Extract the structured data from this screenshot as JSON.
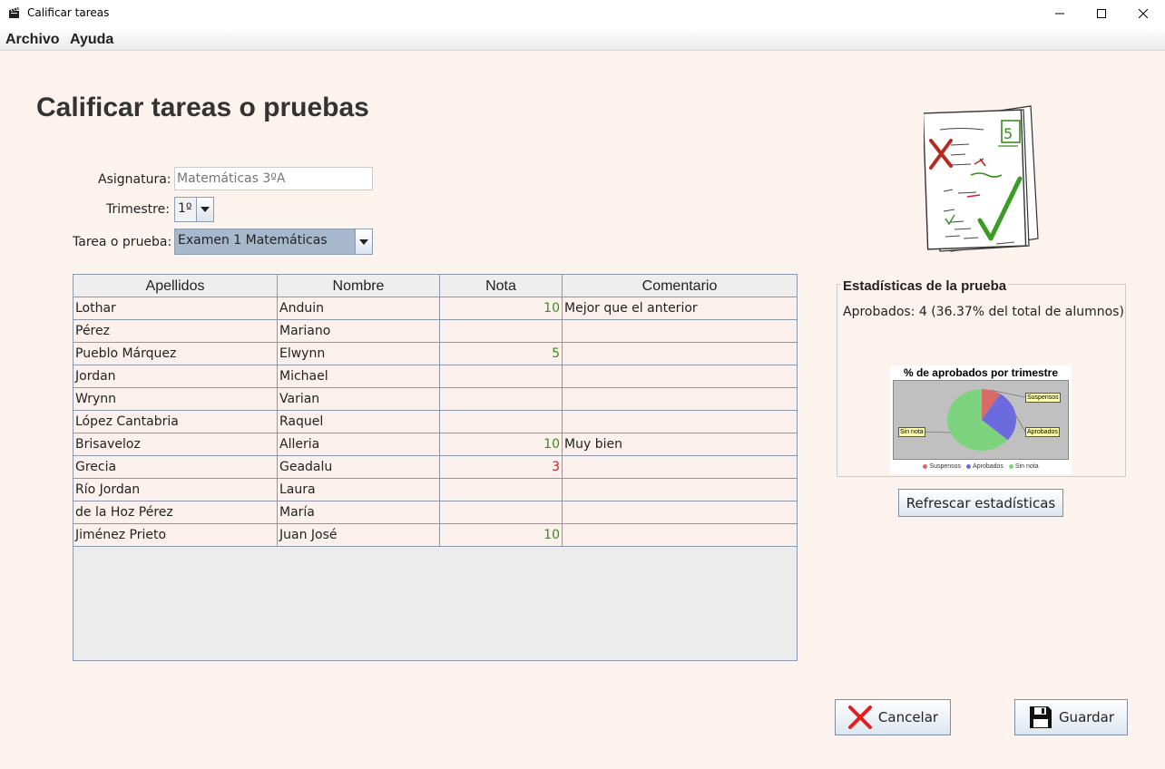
{
  "window": {
    "title": "Calificar tareas"
  },
  "menu": {
    "items": [
      "Archivo",
      "Ayuda"
    ]
  },
  "page": {
    "title": "Calificar tareas o pruebas"
  },
  "form": {
    "subject_label": "Asignatura:",
    "subject_placeholder": "Matemáticas 3ºA",
    "term_label": "Trimestre:",
    "term_value": "1º",
    "task_label": "Tarea o prueba:",
    "task_value": "Examen 1 Matemáticas"
  },
  "table": {
    "columns": [
      "Apellidos",
      "Nombre",
      "Nota",
      "Comentario"
    ],
    "rows": [
      {
        "apellidos": "Lothar",
        "nombre": "Anduin",
        "nota": "10",
        "comentario": "Mejor que el anterior"
      },
      {
        "apellidos": "Pérez",
        "nombre": "Mariano",
        "nota": "",
        "comentario": ""
      },
      {
        "apellidos": "Pueblo Márquez",
        "nombre": "Elwynn",
        "nota": "5",
        "comentario": ""
      },
      {
        "apellidos": "Jordan",
        "nombre": "Michael",
        "nota": "",
        "comentario": ""
      },
      {
        "apellidos": "Wrynn",
        "nombre": "Varian",
        "nota": "",
        "comentario": ""
      },
      {
        "apellidos": "López Cantabria",
        "nombre": "Raquel",
        "nota": "",
        "comentario": ""
      },
      {
        "apellidos": "Brisaveloz",
        "nombre": "Alleria",
        "nota": "10",
        "comentario": "Muy bien"
      },
      {
        "apellidos": "Grecia",
        "nombre": "Geadalu",
        "nota": "3",
        "comentario": ""
      },
      {
        "apellidos": "Río Jordan",
        "nombre": "Laura",
        "nota": "",
        "comentario": ""
      },
      {
        "apellidos": "de la Hoz Pérez",
        "nombre": "María",
        "nota": "",
        "comentario": ""
      },
      {
        "apellidos": "Jiménez Prieto",
        "nombre": "Juan José",
        "nota": "10",
        "comentario": ""
      }
    ],
    "pass_color": "#3a8c1e",
    "fail_color": "#d42020"
  },
  "stats": {
    "title": "Estadísticas de la prueba",
    "summary": "Aprobados: 4 (36.37% del total de alumnos)",
    "refresh_label": "Refrescar estadísticas"
  },
  "chart_data": {
    "type": "pie",
    "title": "% de aprobados por trimestre",
    "slices": [
      {
        "name": "Suspensos",
        "value": 9.09,
        "color": "#d96a6a"
      },
      {
        "name": "Aprobados",
        "value": 27.27,
        "color": "#6b6bdd"
      },
      {
        "name": "Sin nota",
        "value": 63.64,
        "color": "#7ed47e"
      }
    ],
    "legend_placement": "bottom"
  },
  "buttons": {
    "cancel": "Cancelar",
    "save": "Guardar"
  },
  "icons": {
    "app": "clapperboard-icon",
    "cancel": "red-x-icon",
    "save": "floppy-disk-icon",
    "illustration": "graded-papers-illustration"
  }
}
